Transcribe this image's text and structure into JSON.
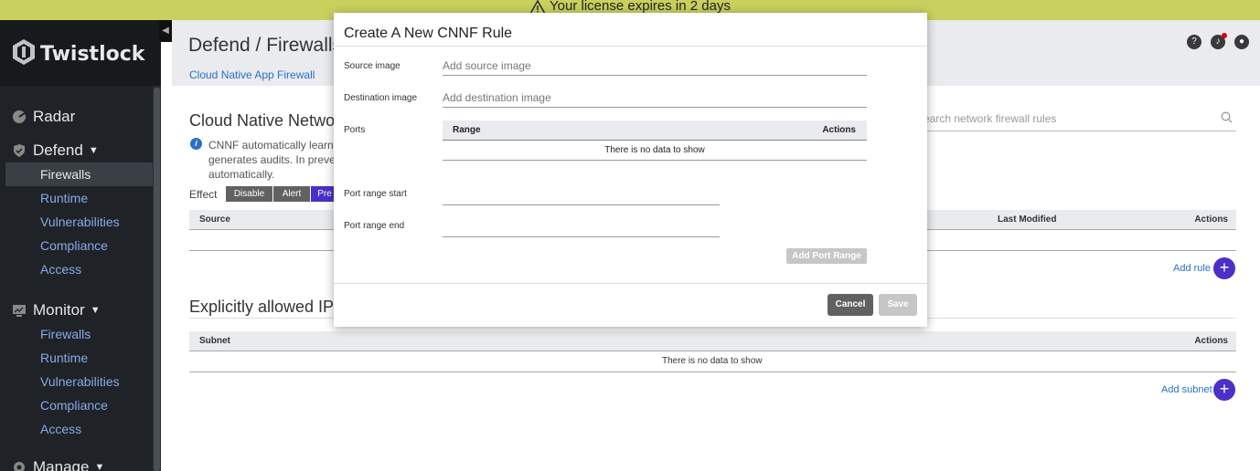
{
  "banner": {
    "text": "Your license expires in 2 days"
  },
  "brand": {
    "name": "Twistlock"
  },
  "sidebar": {
    "radar": "Radar",
    "defend": {
      "label": "Defend",
      "items": [
        "Firewalls",
        "Runtime",
        "Vulnerabilities",
        "Compliance",
        "Access"
      ]
    },
    "monitor": {
      "label": "Monitor",
      "items": [
        "Firewalls",
        "Runtime",
        "Vulnerabilities",
        "Compliance",
        "Access"
      ]
    },
    "manage": "Manage"
  },
  "header": {
    "title": "Defend / Firewalls",
    "subtab": "Cloud Native App Firewall",
    "icons": [
      "help-icon",
      "bell-icon",
      "user-icon"
    ]
  },
  "main": {
    "cnnf_title": "Cloud Native Network",
    "info_text": "CNNF automatically learns r generates audits. In preven automatically.",
    "effect_label": "Effect",
    "effect_options": [
      "Disable",
      "Alert",
      "Pre"
    ],
    "search_placeholder": "earch network firewall rules",
    "rules_table": {
      "source": "Source",
      "last_modified": "Last Modified",
      "actions": "Actions"
    },
    "add_rule": "Add rule",
    "ip_title": "Explicitly allowed IP ra",
    "subnet_table": {
      "subnet": "Subnet",
      "actions": "Actions",
      "empty": "There is no data to show"
    },
    "add_subnet": "Add subnet"
  },
  "modal": {
    "title": "Create A New CNNF Rule",
    "source_label": "Source image",
    "source_placeholder": "Add source image",
    "dest_label": "Destination image",
    "dest_placeholder": "Add destination image",
    "ports_label": "Ports",
    "ports_table": {
      "range": "Range",
      "actions": "Actions",
      "empty": "There is no data to show"
    },
    "range_start_label": "Port range start",
    "range_end_label": "Port range end",
    "add_port_range": "Add Port Range",
    "cancel": "Cancel",
    "save": "Save"
  },
  "colors": {
    "banner": "#c9d05e",
    "sidebar": "#1f2327",
    "accent": "#4b2fc7",
    "link": "#2a6fc9"
  }
}
